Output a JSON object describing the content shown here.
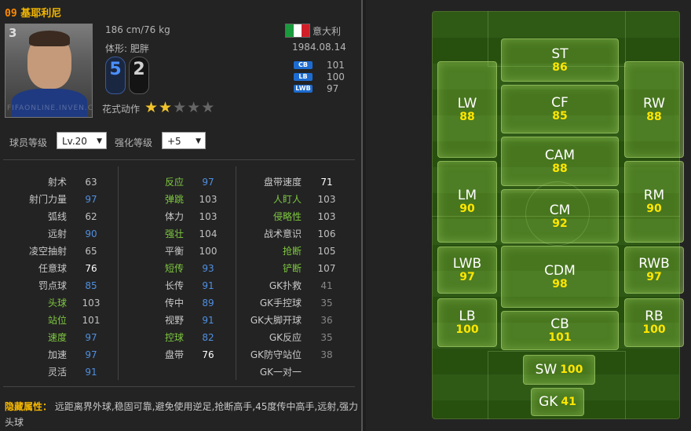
{
  "player": {
    "season": "09",
    "name": "基耶利尼",
    "number": "3",
    "height_weight": "186 cm/76 kg",
    "body_type": "体形: 肥胖",
    "nationality": "意大利",
    "birthdate": "1984.08.14",
    "left_foot": "5",
    "right_foot": "2",
    "skill_moves_label": "花式动作",
    "skill_stars": 2,
    "skill_stars_max": 5,
    "watermark": "FIFAONLINE.INVEN.CO.KR",
    "positions": [
      {
        "badge": "CB",
        "value": "101"
      },
      {
        "badge": "LB",
        "value": "100"
      },
      {
        "badge": "LWB",
        "value": "97"
      }
    ]
  },
  "colors": {
    "flag": [
      "#1a9a3c",
      "#ffffff",
      "#d11f2a"
    ],
    "accent": "#f5b800",
    "green_label": "#7ec840",
    "blue_value": "#4f8fe0",
    "ovr_yellow": "#ffe600"
  },
  "controls": {
    "level_label": "球员等级",
    "level_value": "Lv.20",
    "enhance_label": "强化等级",
    "enhance_value": "+5"
  },
  "stats": {
    "col1": [
      {
        "label": "射术",
        "value": "63"
      },
      {
        "label": "射门力量",
        "value": "97"
      },
      {
        "label": "弧线",
        "value": "62"
      },
      {
        "label": "远射",
        "value": "90"
      },
      {
        "label": "凌空抽射",
        "value": "65"
      },
      {
        "label": "任意球",
        "value": "76"
      },
      {
        "label": "罚点球",
        "value": "85"
      },
      {
        "label": "头球",
        "value": "103"
      },
      {
        "label": "站位",
        "value": "101"
      },
      {
        "label": "速度",
        "value": "97"
      },
      {
        "label": "加速",
        "value": "97"
      },
      {
        "label": "灵活",
        "value": "91"
      }
    ],
    "col2": [
      {
        "label": "反应",
        "value": "97"
      },
      {
        "label": "弹跳",
        "value": "103"
      },
      {
        "label": "体力",
        "value": "103"
      },
      {
        "label": "强壮",
        "value": "104"
      },
      {
        "label": "平衡",
        "value": "100"
      },
      {
        "label": "短传",
        "value": "93"
      },
      {
        "label": "长传",
        "value": "91"
      },
      {
        "label": "传中",
        "value": "89"
      },
      {
        "label": "视野",
        "value": "91"
      },
      {
        "label": "控球",
        "value": "82"
      },
      {
        "label": "盘带",
        "value": "76"
      }
    ],
    "col3": [
      {
        "label": "盘带速度",
        "value": "71"
      },
      {
        "label": "人盯人",
        "value": "103"
      },
      {
        "label": "侵略性",
        "value": "103"
      },
      {
        "label": "战术意识",
        "value": "106"
      },
      {
        "label": "抢断",
        "value": "105"
      },
      {
        "label": "铲断",
        "value": "107"
      },
      {
        "label": "GK扑救",
        "value": "41"
      },
      {
        "label": "GK手控球",
        "value": "35"
      },
      {
        "label": "GK大脚开球",
        "value": "36"
      },
      {
        "label": "GK反应",
        "value": "35"
      },
      {
        "label": "GK防守站位",
        "value": "38"
      },
      {
        "label": "GK一对一",
        "value": ""
      }
    ]
  },
  "hidden_traits": {
    "label": "隐藏属性：",
    "text": "远距离界外球,稳固可靠,避免使用逆足,抢断高手,45度传中高手,远射,强力头球"
  },
  "pitch": {
    "positions": [
      {
        "pos": "ST",
        "ovr": "86"
      },
      {
        "pos": "LW",
        "ovr": "88"
      },
      {
        "pos": "CF",
        "ovr": "85"
      },
      {
        "pos": "RW",
        "ovr": "88"
      },
      {
        "pos": "CAM",
        "ovr": "88"
      },
      {
        "pos": "LM",
        "ovr": "90"
      },
      {
        "pos": "CM",
        "ovr": "92"
      },
      {
        "pos": "RM",
        "ovr": "90"
      },
      {
        "pos": "LWB",
        "ovr": "97"
      },
      {
        "pos": "CDM",
        "ovr": "98"
      },
      {
        "pos": "RWB",
        "ovr": "97"
      },
      {
        "pos": "LB",
        "ovr": "100"
      },
      {
        "pos": "CB",
        "ovr": "101"
      },
      {
        "pos": "RB",
        "ovr": "100"
      },
      {
        "pos": "SW",
        "ovr": "100"
      },
      {
        "pos": "GK",
        "ovr": "41"
      }
    ]
  }
}
